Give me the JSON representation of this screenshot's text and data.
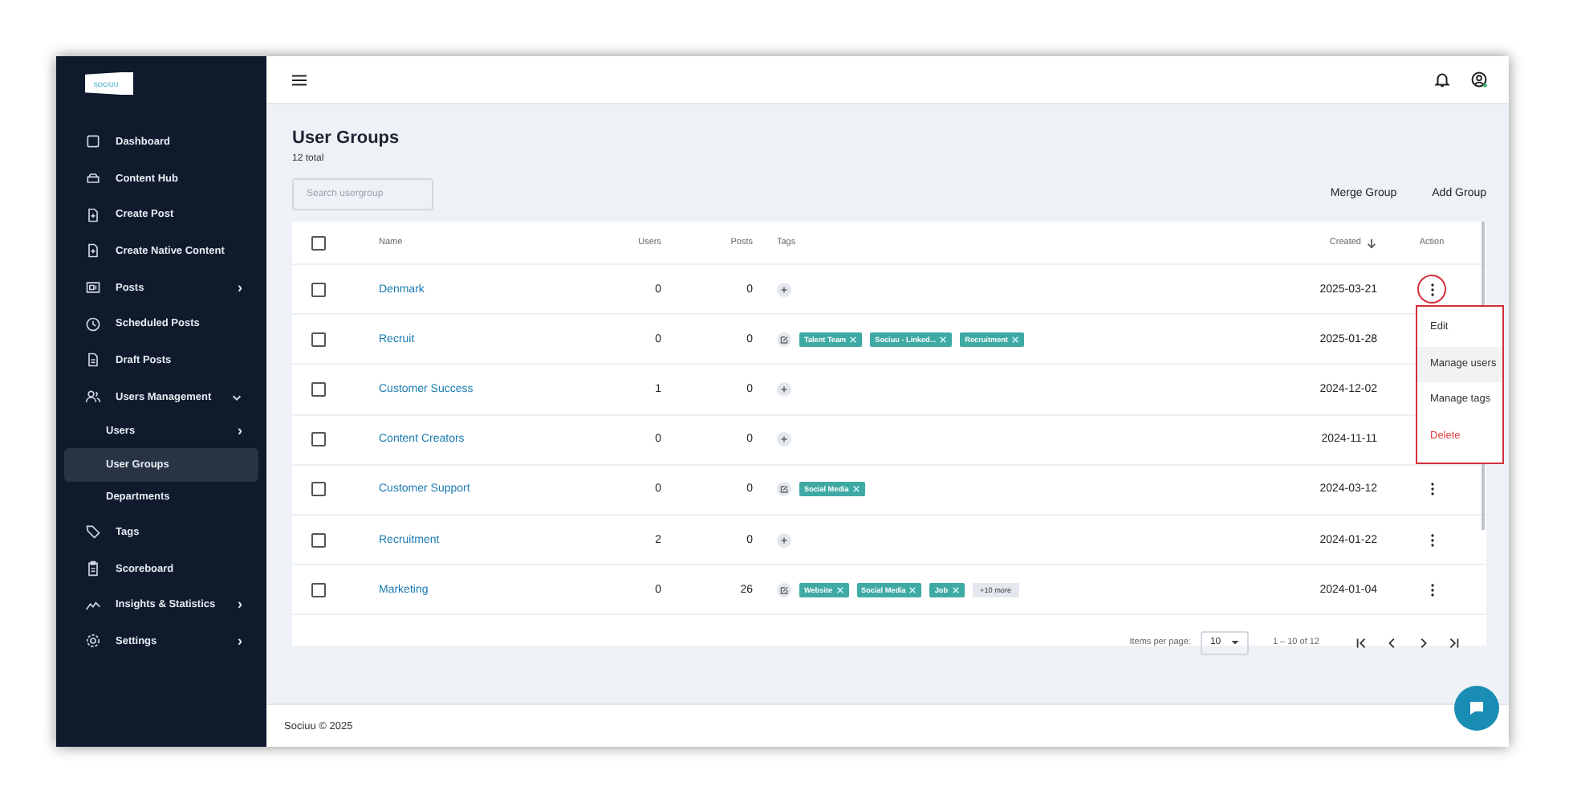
{
  "logo": {
    "text": "SOCIUU"
  },
  "sidebar": {
    "items": [
      {
        "label": "Dashboard",
        "selected": false
      },
      {
        "label": "Content Hub",
        "selected": false
      },
      {
        "label": "Create Post",
        "selected": false
      },
      {
        "label": "Create Native Content",
        "selected": false
      },
      {
        "label": "Posts",
        "chevron": "›",
        "selected": false
      },
      {
        "label": "Scheduled Posts",
        "selected": false
      },
      {
        "label": "Draft Posts",
        "selected": false
      },
      {
        "label": "Users Management",
        "expanded": true,
        "selected": false,
        "children": [
          {
            "label": "Users",
            "chevron": "›",
            "selected": false
          },
          {
            "label": "User Groups",
            "selected": true
          },
          {
            "label": "Departments",
            "selected": false
          }
        ]
      },
      {
        "label": "Tags",
        "selected": false
      },
      {
        "label": "Scoreboard",
        "selected": false
      },
      {
        "label": "Insights & Statistics",
        "chevron": "›",
        "selected": false
      },
      {
        "label": "Settings",
        "chevron": "›",
        "selected": false
      }
    ]
  },
  "page": {
    "title": "User Groups",
    "subtitle": "12 total",
    "search": {
      "placeholder": "Search usergroup"
    },
    "buttons": [
      "Merge Group",
      "Add Group"
    ]
  },
  "table": {
    "select_all_checked": false,
    "columns": [
      "Name",
      "Users",
      "Posts",
      "Tags",
      "Created",
      "Action"
    ],
    "rows": [
      {
        "checked": false,
        "name": "Denmark",
        "users": "0",
        "posts": "0",
        "tag_button": {
          "kind": "add"
        },
        "tags": [],
        "created": "2025-03-21",
        "menu_open": true
      },
      {
        "checked": false,
        "name": "Recruit",
        "users": "0",
        "posts": "0",
        "tag_button": {
          "kind": "edit"
        },
        "tags": [
          "Talent Team",
          "Sociuu - Linked...",
          "Recruitment"
        ],
        "created": "2025-01-28",
        "menu_open": false
      },
      {
        "checked": false,
        "name": "Customer Success",
        "users": "1",
        "posts": "0",
        "tag_button": {
          "kind": "add"
        },
        "tags": [],
        "created": "2024-12-02",
        "menu_open": false
      },
      {
        "checked": false,
        "name": "Content Creators",
        "users": "0",
        "posts": "0",
        "tag_button": {
          "kind": "add"
        },
        "tags": [],
        "created": "2024-11-11",
        "menu_open": false
      },
      {
        "checked": false,
        "name": "Customer Support",
        "users": "0",
        "posts": "0",
        "tag_button": {
          "kind": "edit"
        },
        "tags": [
          "Social Media"
        ],
        "created": "2024-03-12",
        "menu_open": false
      },
      {
        "checked": false,
        "name": "Recruitment",
        "users": "2",
        "posts": "0",
        "tag_button": {
          "kind": "add"
        },
        "tags": [],
        "created": "2024-01-22",
        "menu_open": false
      },
      {
        "checked": false,
        "name": "Marketing",
        "users": "0",
        "posts": "26",
        "tag_button": {
          "kind": "edit"
        },
        "tags": [
          "Website",
          "Social Media",
          "Job"
        ],
        "more": "+10 more",
        "created": "2024-01-04",
        "menu_open": false
      }
    ],
    "action_menu": [
      {
        "label": "Edit",
        "kind": "normal",
        "highlighted": false
      },
      {
        "label": "Manage users",
        "kind": "normal",
        "highlighted": true
      },
      {
        "label": "Manage tags",
        "kind": "normal",
        "highlighted": false
      },
      {
        "label": "Delete",
        "kind": "danger",
        "highlighted": false
      }
    ]
  },
  "pagination": {
    "label": "Items per page:",
    "page_size": "10",
    "range": "1 – 10 of 12"
  },
  "footer": {
    "text": "Sociuu © 2025"
  }
}
